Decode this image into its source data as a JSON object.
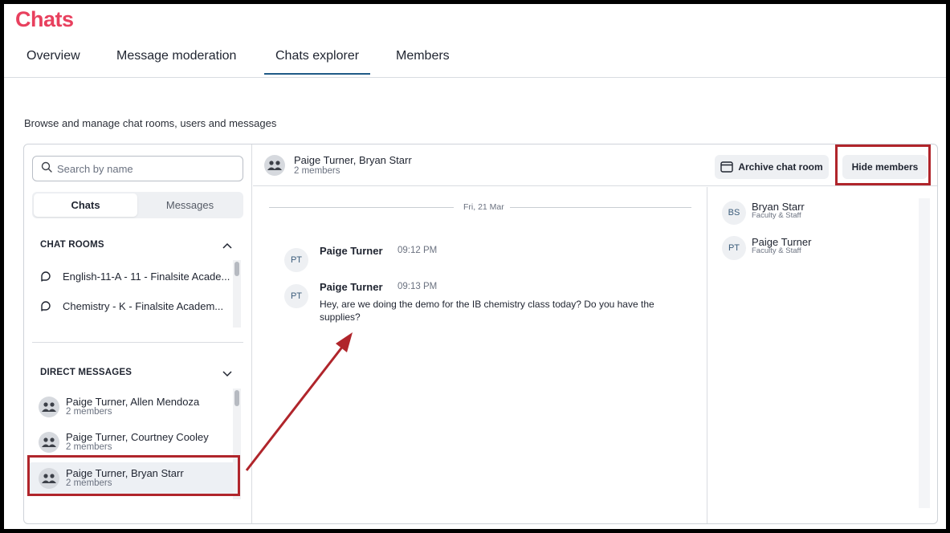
{
  "page": {
    "title": "Chats"
  },
  "tabs": [
    {
      "label": "Overview"
    },
    {
      "label": "Message moderation"
    },
    {
      "label": "Chats explorer",
      "active": true
    },
    {
      "label": "Members"
    }
  ],
  "subtitle": "Browse and manage chat rooms, users and messages",
  "sidebar": {
    "search_placeholder": "Search by name",
    "segments": [
      {
        "label": "Chats",
        "active": true
      },
      {
        "label": "Messages"
      }
    ],
    "chat_rooms_heading": "CHAT ROOMS",
    "chat_rooms": [
      {
        "label": "English-11-A - 11 - Finalsite Acade..."
      },
      {
        "label": "Chemistry - K - Finalsite Academ..."
      }
    ],
    "direct_messages_heading": "DIRECT MESSAGES",
    "direct_messages": [
      {
        "name": "Paige Turner, Allen Mendoza",
        "sub": "2 members"
      },
      {
        "name": "Paige Turner, Courtney Cooley",
        "sub": "2 members"
      },
      {
        "name": "Paige Turner, Bryan Starr",
        "sub": "2 members",
        "selected": true
      }
    ]
  },
  "chat": {
    "title": "Paige Turner, Bryan Starr",
    "subtitle": "2 members",
    "archive_label": "Archive chat room",
    "hide_members_label": "Hide members",
    "date_separator": "Fri, 21 Mar",
    "messages": [
      {
        "initials": "PT",
        "author": "Paige Turner",
        "time": "09:12 PM",
        "text": ""
      },
      {
        "initials": "PT",
        "author": "Paige Turner",
        "time": "09:13 PM",
        "text": "Hey, are we doing the demo for the IB chemistry class today? Do you have the supplies?"
      }
    ]
  },
  "members": [
    {
      "initials": "BS",
      "name": "Bryan Starr",
      "role": "Faculty & Staff"
    },
    {
      "initials": "PT",
      "name": "Paige Turner",
      "role": "Faculty & Staff"
    }
  ],
  "colors": {
    "brand": "#e8405e",
    "tab_underline": "#1f5a86",
    "annotation": "#b0252b"
  }
}
